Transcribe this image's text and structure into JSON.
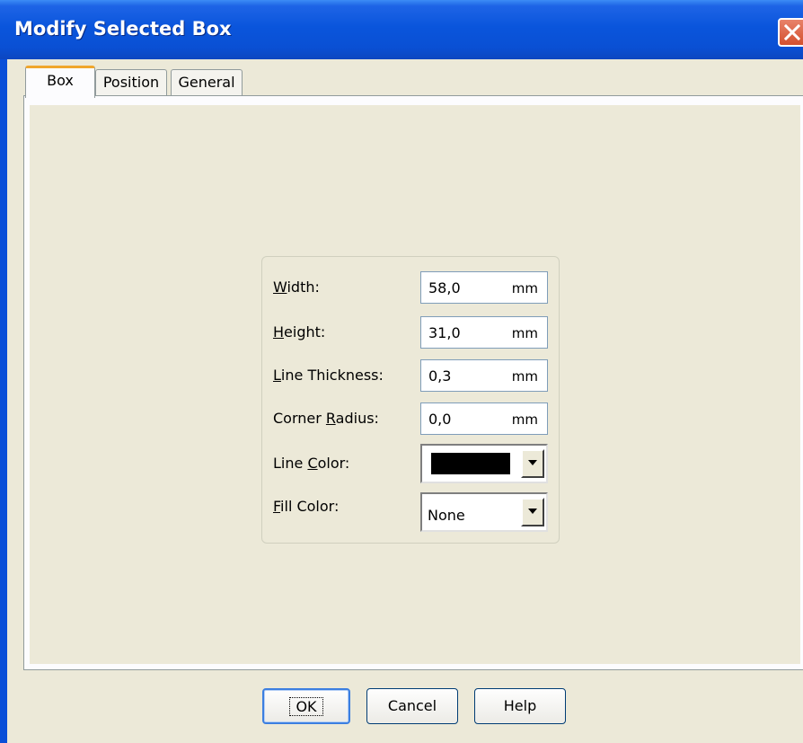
{
  "window": {
    "title": "Modify Selected Box"
  },
  "tabs": [
    {
      "label": "Box",
      "active": true
    },
    {
      "label": "Position",
      "active": false
    },
    {
      "label": "General",
      "active": false
    }
  ],
  "fields": {
    "width": {
      "label": "Width:",
      "value": "58,0",
      "unit": "mm"
    },
    "height": {
      "label": "Height:",
      "value": "31,0",
      "unit": "mm"
    },
    "line_thickness": {
      "label": "Line Thickness:",
      "value": "0,3",
      "unit": "mm"
    },
    "corner_radius": {
      "label": "Corner Radius:",
      "value": "0,0",
      "unit": "mm"
    },
    "line_color": {
      "label": "Line Color:",
      "color": "#000000"
    },
    "fill_color": {
      "label": "Fill Color:",
      "value": "None"
    }
  },
  "buttons": {
    "ok": "OK",
    "cancel": "Cancel",
    "help": "Help"
  }
}
